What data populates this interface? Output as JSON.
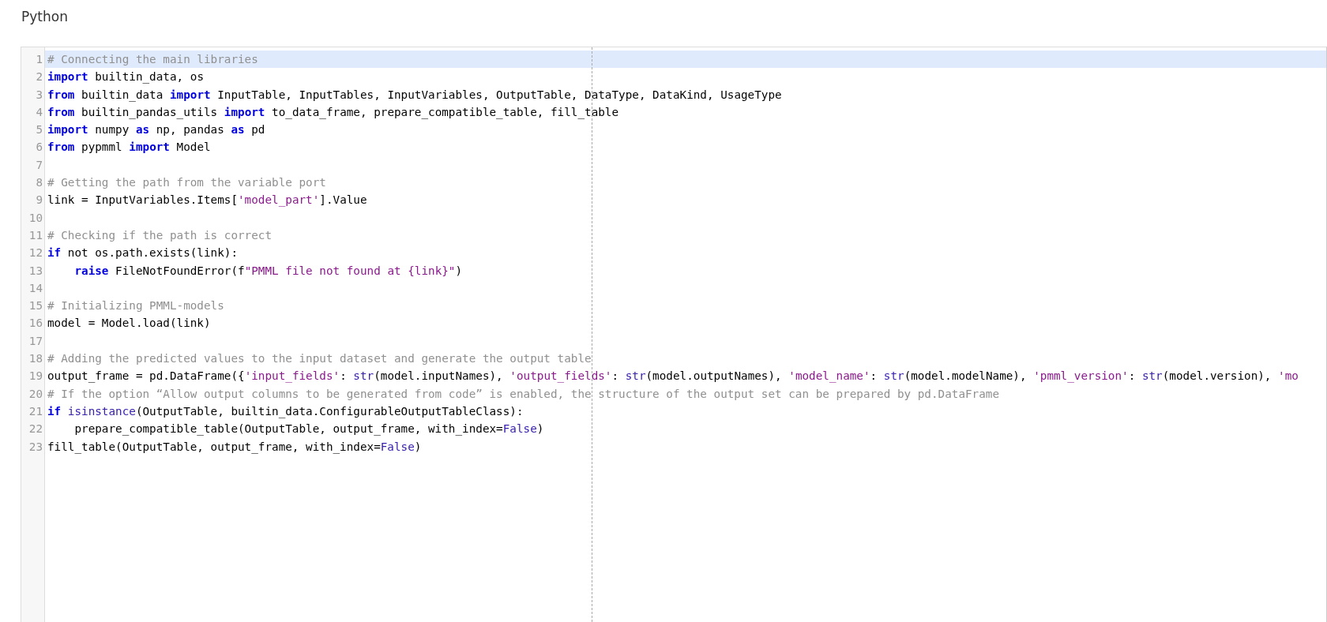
{
  "title": "Python",
  "editor": {
    "lines": [
      {
        "number": "1",
        "selected": true,
        "tokens": [
          {
            "kind": "comment",
            "text": "# Connecting the main libraries"
          }
        ]
      },
      {
        "number": "2",
        "selected": false,
        "tokens": [
          {
            "kind": "keyword",
            "text": "import"
          },
          {
            "kind": "plain",
            "text": " builtin_data, os"
          }
        ]
      },
      {
        "number": "3",
        "selected": false,
        "tokens": [
          {
            "kind": "keyword",
            "text": "from"
          },
          {
            "kind": "plain",
            "text": " builtin_data "
          },
          {
            "kind": "keyword",
            "text": "import"
          },
          {
            "kind": "plain",
            "text": " InputTable, InputTables, InputVariables, OutputTable, DataType, DataKind, UsageType"
          }
        ]
      },
      {
        "number": "4",
        "selected": false,
        "tokens": [
          {
            "kind": "keyword",
            "text": "from"
          },
          {
            "kind": "plain",
            "text": " builtin_pandas_utils "
          },
          {
            "kind": "keyword",
            "text": "import"
          },
          {
            "kind": "plain",
            "text": " to_data_frame, prepare_compatible_table, fill_table"
          }
        ]
      },
      {
        "number": "5",
        "selected": false,
        "tokens": [
          {
            "kind": "keyword",
            "text": "import"
          },
          {
            "kind": "plain",
            "text": " numpy "
          },
          {
            "kind": "keyword",
            "text": "as"
          },
          {
            "kind": "plain",
            "text": " np, pandas "
          },
          {
            "kind": "keyword",
            "text": "as"
          },
          {
            "kind": "plain",
            "text": " pd"
          }
        ]
      },
      {
        "number": "6",
        "selected": false,
        "tokens": [
          {
            "kind": "keyword",
            "text": "from"
          },
          {
            "kind": "plain",
            "text": " pypmml "
          },
          {
            "kind": "keyword",
            "text": "import"
          },
          {
            "kind": "plain",
            "text": " Model"
          }
        ]
      },
      {
        "number": "7",
        "selected": false
      },
      {
        "number": "8",
        "selected": false,
        "tokens": [
          {
            "kind": "comment",
            "text": "# Getting the path from the variable port"
          }
        ]
      },
      {
        "number": "9",
        "selected": false,
        "tokens": [
          {
            "kind": "plain",
            "text": "link = InputVariables.Items["
          },
          {
            "kind": "string",
            "text": "'model_part'"
          },
          {
            "kind": "plain",
            "text": "].Value"
          }
        ]
      },
      {
        "number": "10",
        "selected": false
      },
      {
        "number": "11",
        "selected": false,
        "tokens": [
          {
            "kind": "comment",
            "text": "# Checking if the path is correct"
          }
        ]
      },
      {
        "number": "12",
        "selected": false,
        "tokens": [
          {
            "kind": "keyword",
            "text": "if"
          },
          {
            "kind": "plain",
            "text": " not os.path.exists(link):"
          }
        ]
      },
      {
        "number": "13",
        "selected": false,
        "tokens": [
          {
            "kind": "keyword",
            "text": "    raise"
          },
          {
            "kind": "plain",
            "text": " FileNotFoundError(f"
          },
          {
            "kind": "string",
            "text": "\"PMML file not found at {link}\""
          },
          {
            "kind": "plain",
            "text": ")"
          }
        ]
      },
      {
        "number": "14",
        "selected": false
      },
      {
        "number": "15",
        "selected": false,
        "tokens": [
          {
            "kind": "comment",
            "text": "# Initializing PMML-models"
          }
        ]
      },
      {
        "number": "16",
        "selected": false,
        "tokens": [
          {
            "kind": "plain",
            "text": "model = Model.load(link)"
          }
        ]
      },
      {
        "number": "17",
        "selected": false
      },
      {
        "number": "18",
        "selected": false,
        "tokens": [
          {
            "kind": "comment",
            "text": "# Adding the predicted values to the input dataset and generate the output table"
          }
        ]
      },
      {
        "number": "19",
        "selected": false,
        "tokens": [
          {
            "kind": "plain",
            "text": "output_frame = pd.DataFrame({"
          },
          {
            "kind": "string",
            "text": "'input_fields'"
          },
          {
            "kind": "plain",
            "text": ": "
          },
          {
            "kind": "builtin",
            "text": "str"
          },
          {
            "kind": "plain",
            "text": "(model.inputNames), "
          },
          {
            "kind": "string",
            "text": "'output_fields'"
          },
          {
            "kind": "plain",
            "text": ": "
          },
          {
            "kind": "builtin",
            "text": "str"
          },
          {
            "kind": "plain",
            "text": "(model.outputNames), "
          },
          {
            "kind": "string",
            "text": "'model_name'"
          },
          {
            "kind": "plain",
            "text": ": "
          },
          {
            "kind": "builtin",
            "text": "str"
          },
          {
            "kind": "plain",
            "text": "(model.modelName), "
          },
          {
            "kind": "string",
            "text": "'pmml_version'"
          },
          {
            "kind": "plain",
            "text": ": "
          },
          {
            "kind": "builtin",
            "text": "str"
          },
          {
            "kind": "plain",
            "text": "(model.version), "
          },
          {
            "kind": "string",
            "text": "'mo"
          }
        ]
      },
      {
        "number": "20",
        "selected": false,
        "tokens": [
          {
            "kind": "comment",
            "text": "# If the option “Allow output columns to be generated from code” is enabled, the structure of the output set can be prepared by pd.DataFrame"
          }
        ]
      },
      {
        "number": "21",
        "selected": false,
        "tokens": [
          {
            "kind": "keyword",
            "text": "if"
          },
          {
            "kind": "builtin",
            "text": " isinstance"
          },
          {
            "kind": "plain",
            "text": "(OutputTable, builtin_data.ConfigurableOutputTableClass):"
          }
        ]
      },
      {
        "number": "22",
        "selected": false,
        "tokens": [
          {
            "kind": "plain",
            "text": "    prepare_compatible_table(OutputTable, output_frame, with_index="
          },
          {
            "kind": "builtin",
            "text": "False"
          },
          {
            "kind": "plain",
            "text": ")"
          }
        ]
      },
      {
        "number": "23",
        "selected": false,
        "tokens": [
          {
            "kind": "plain",
            "text": "fill_table(OutputTable, output_frame, with_index="
          },
          {
            "kind": "builtin",
            "text": "False"
          },
          {
            "kind": "plain",
            "text": ")"
          }
        ]
      }
    ]
  }
}
